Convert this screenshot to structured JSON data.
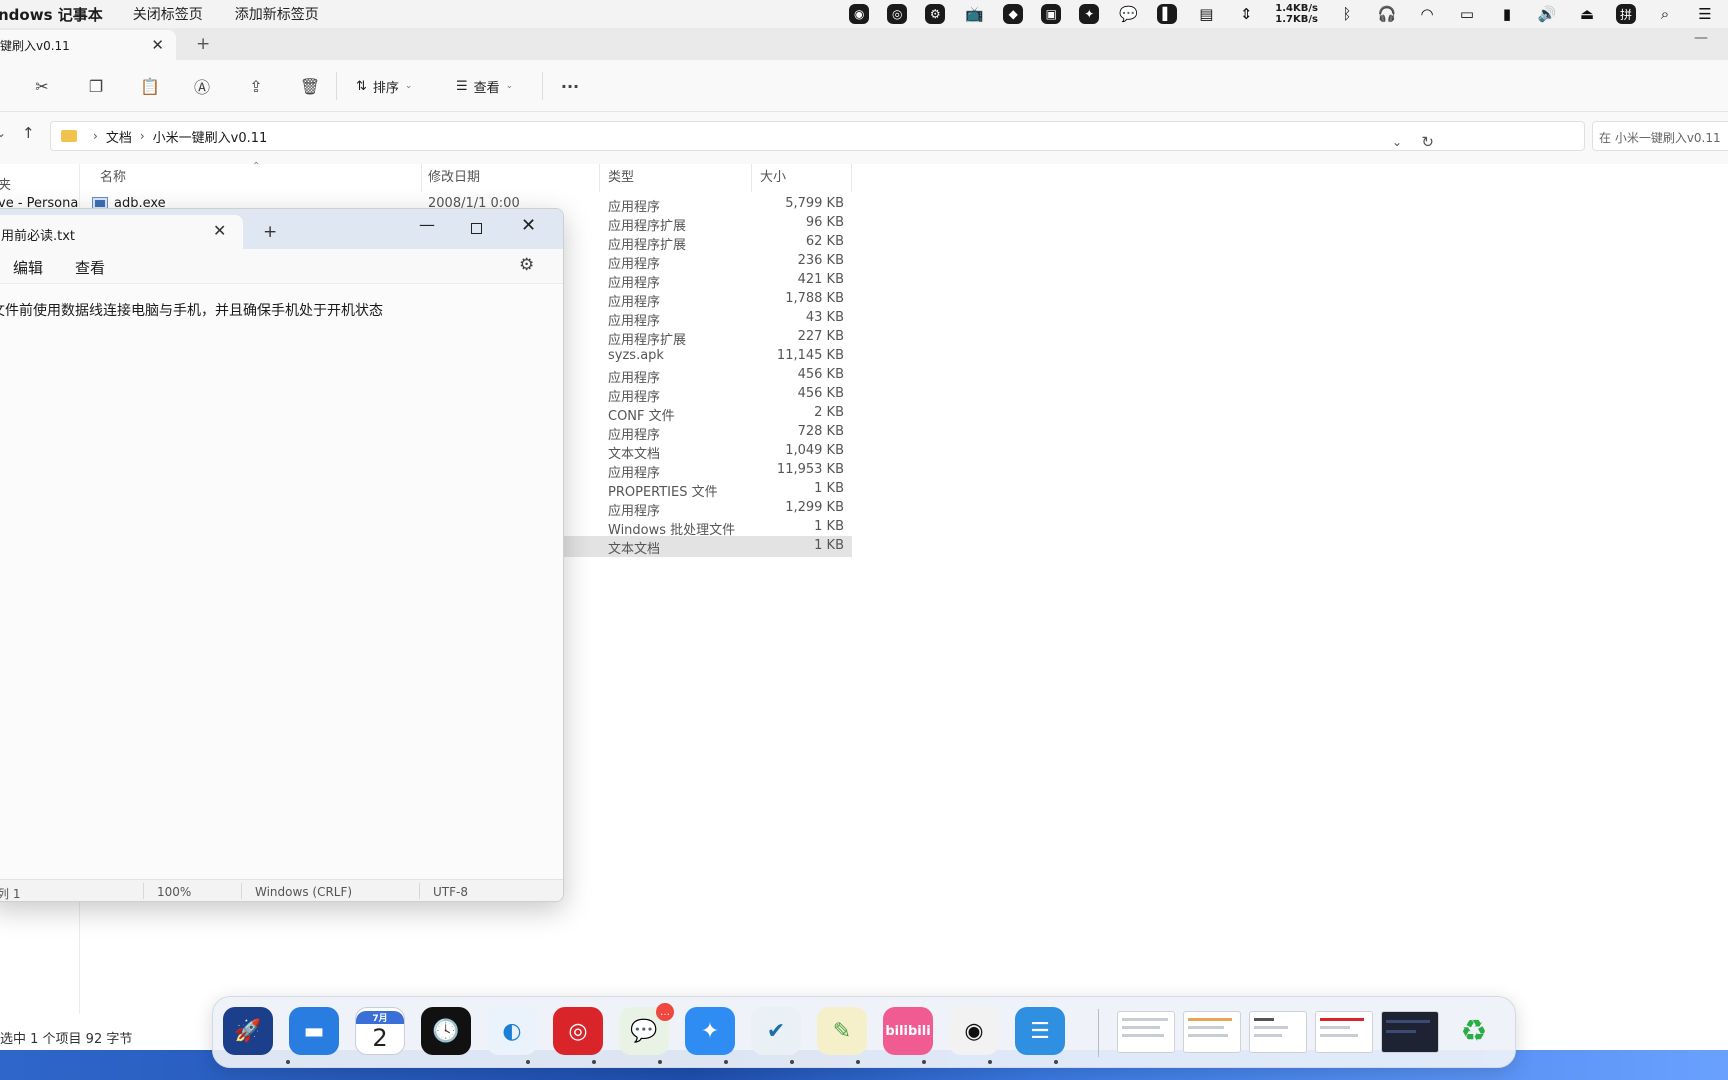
{
  "menubar": {
    "app_name": "ndows 记事本",
    "items": [
      "关闭标签页",
      "添加新标签页"
    ],
    "net_up": "1.4KB/s",
    "net_down": "1.7KB/s"
  },
  "explorer": {
    "tab_title": "键刷入v0.11",
    "toolbar": {
      "sort_label": "排序",
      "view_label": "查看",
      "more": "···"
    },
    "breadcrumb": [
      "文档",
      "小米一键刷入v0.11"
    ],
    "search_placeholder": "在 小米一键刷入v0.11",
    "nav": {
      "header": "夹",
      "onedrive": "ve - Persona"
    },
    "columns": {
      "name": "名称",
      "date": "修改日期",
      "type": "类型",
      "size": "大小"
    },
    "files": [
      {
        "name": "adb.exe",
        "date": "2008/1/1 0:00",
        "type": "应用程序",
        "size": "5,799 KB"
      },
      {
        "name": "",
        "date": "",
        "type": "应用程序扩展",
        "size": "96 KB"
      },
      {
        "name": "",
        "date": "",
        "type": "应用程序扩展",
        "size": "62 KB"
      },
      {
        "name": "",
        "date": "",
        "type": "应用程序",
        "size": "236 KB"
      },
      {
        "name": "",
        "date": "",
        "type": "应用程序",
        "size": "421 KB"
      },
      {
        "name": "",
        "date": "",
        "type": "应用程序",
        "size": "1,788 KB"
      },
      {
        "name": "",
        "date": "",
        "type": "应用程序",
        "size": "43 KB"
      },
      {
        "name": "",
        "date": "",
        "type": "应用程序扩展",
        "size": "227 KB"
      },
      {
        "name": "",
        "date": "",
        "type": "syzs.apk",
        "size": "11,145 KB"
      },
      {
        "name": "",
        "date": "",
        "type": "应用程序",
        "size": "456 KB"
      },
      {
        "name": "",
        "date": "",
        "type": "应用程序",
        "size": "456 KB"
      },
      {
        "name": "",
        "date": "",
        "type": "CONF 文件",
        "size": "2 KB"
      },
      {
        "name": "",
        "date": "",
        "type": "应用程序",
        "size": "728 KB"
      },
      {
        "name": "",
        "date": "",
        "type": "文本文档",
        "size": "1,049 KB"
      },
      {
        "name": "",
        "date": "",
        "type": "应用程序",
        "size": "11,953 KB"
      },
      {
        "name": "",
        "date": "",
        "type": "PROPERTIES 文件",
        "size": "1 KB"
      },
      {
        "name": "",
        "date": "",
        "type": "应用程序",
        "size": "1,299 KB"
      },
      {
        "name": "",
        "date": "",
        "type": "Windows 批处理文件",
        "size": "1 KB"
      },
      {
        "name": "",
        "date": "",
        "type": "文本文档",
        "size": "1 KB",
        "selected": true
      }
    ],
    "status": "选中 1 个项目  92 字节"
  },
  "notepad": {
    "tab_title": "用前必读.txt",
    "menu": [
      "编辑",
      "查看"
    ],
    "content": "文件前使用数据线连接电脑与手机，并且确保手机处于开机状态",
    "status": {
      "position": "列 1",
      "zoom": "100%",
      "line_ending": "Windows (CRLF)",
      "encoding": "UTF-8"
    }
  },
  "dock": {
    "calendar_month": "7月",
    "calendar_day": "2",
    "wechat_badge": "…",
    "bilibili_label": "bilibili",
    "apps": [
      "launchpad-icon",
      "finder-desktop-icon",
      "calendar-icon",
      "clock-icon",
      "edge-icon",
      "netease-music-icon",
      "wechat-icon",
      "dingtalk-icon",
      "vmware-icon",
      "notes-icon",
      "bilibili-icon",
      "obs-icon",
      "notepad-icon"
    ]
  },
  "colors": {
    "accent": "#0067c0",
    "wallpaper": "#2f66c9",
    "selection": "#e3e3e3"
  }
}
